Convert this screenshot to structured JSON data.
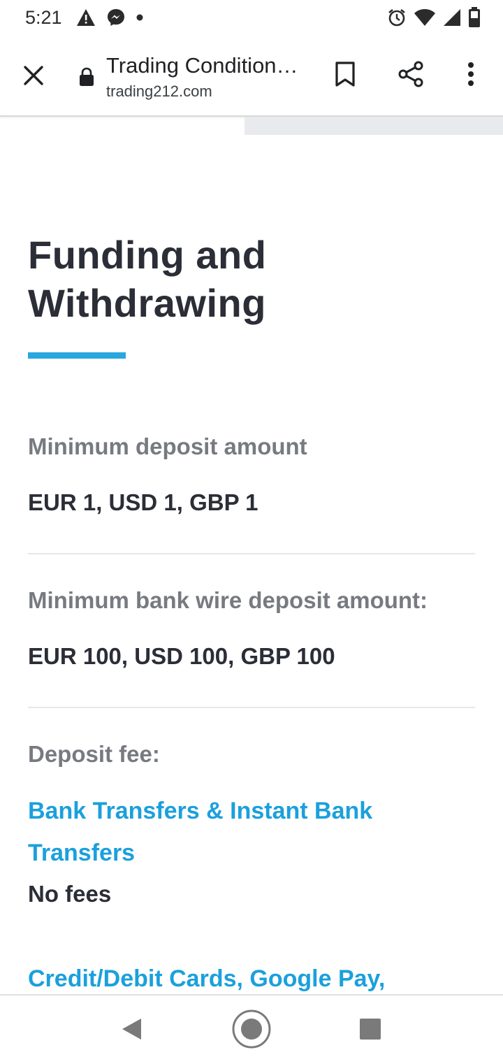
{
  "status_bar": {
    "time": "5:21",
    "left_icons": [
      "warning-icon",
      "messenger-icon",
      "dot-icon"
    ],
    "right_icons": [
      "alarm-icon",
      "wifi-icon",
      "signal-icon",
      "battery-icon"
    ]
  },
  "toolbar": {
    "title": "Trading Condition…",
    "url": "trading212.com",
    "icons": [
      "close-icon",
      "lock-icon",
      "bookmark-icon",
      "share-icon",
      "more-vert-icon"
    ]
  },
  "content": {
    "heading": "Funding and Withdrawing",
    "sections": [
      {
        "label": "Minimum deposit amount",
        "value": "EUR 1, USD 1, GBP 1"
      },
      {
        "label": "Minimum bank wire deposit amount:",
        "value": "EUR 100, USD 100, GBP 100"
      }
    ],
    "deposit_fee": {
      "label": "Deposit fee:",
      "bank_link": "Bank Transfers & Instant Bank Transfers",
      "bank_value": "No fees",
      "cards_link": "Credit/Debit Cards, Google Pay,"
    }
  },
  "colors": {
    "accent": "#29a7df",
    "link": "#1ba0dc",
    "heading": "#2b2d37",
    "label": "#777a80"
  },
  "nav_bar": {
    "icons": [
      "back-icon",
      "home-icon",
      "recents-icon"
    ]
  }
}
